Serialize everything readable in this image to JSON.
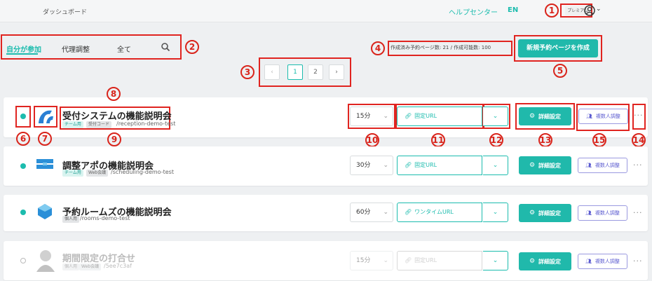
{
  "header": {
    "breadcrumb": "ダッシュボード",
    "help_center": "ヘルプセンター",
    "lang": "EN",
    "plan_badge": "プレミアム",
    "avatar_icon": "user-circle-icon",
    "chevron": "⌄"
  },
  "tabs": [
    {
      "label": "自分が参加",
      "active": true
    },
    {
      "label": "代理調整",
      "active": false
    },
    {
      "label": "全て",
      "active": false
    }
  ],
  "search_icon": "⌕",
  "stats_text": "作成済み予約ページ数: 21 / 作成可能数: 100",
  "new_page_button": "新規予約ページを作成",
  "pagination": {
    "prev": "‹",
    "pages": [
      "1",
      "2"
    ],
    "current": "1",
    "next": "›"
  },
  "rows": [
    {
      "title": "受付システムの機能説明会",
      "tags": [
        "チーム用",
        "受付コード"
      ],
      "path": "/reception-demo-test",
      "duration": "15分",
      "url_type": "固定URL",
      "active": true,
      "icon": "reception-logo-icon"
    },
    {
      "title": "調整アポの機能説明会",
      "tags": [
        "チーム用",
        "Web会議"
      ],
      "path": "/scheduling-demo-test",
      "duration": "30分",
      "url_type": "固定URL",
      "active": true,
      "icon": "scheduling-logo-icon"
    },
    {
      "title": "予約ルームズの機能説明会",
      "tags": [
        "個人用"
      ],
      "path": "/rooms-demo-test",
      "duration": "60分",
      "url_type": "ワンタイムURL",
      "active": true,
      "icon": "rooms-logo-icon"
    },
    {
      "title": "期間限定の打合せ",
      "tags": [
        "個人用",
        "Web会議"
      ],
      "path": "/5ee7c3af",
      "duration": "15分",
      "url_type": "固定URL",
      "active": false,
      "icon": "avatar-photo-icon"
    }
  ],
  "row_buttons": {
    "detail": "詳細設定",
    "multi": "複数人調整",
    "more": "···",
    "dropdown_chevron": "⌄",
    "duration_chevron": "⌄"
  },
  "markers": [
    "1",
    "2",
    "3",
    "4",
    "5",
    "6",
    "7",
    "8",
    "9",
    "10",
    "11",
    "12",
    "13",
    "14",
    "15"
  ],
  "colors": {
    "accent": "#1cbcae",
    "annotation_red": "#d9241b",
    "secondary_purple": "#5b5bd0"
  }
}
